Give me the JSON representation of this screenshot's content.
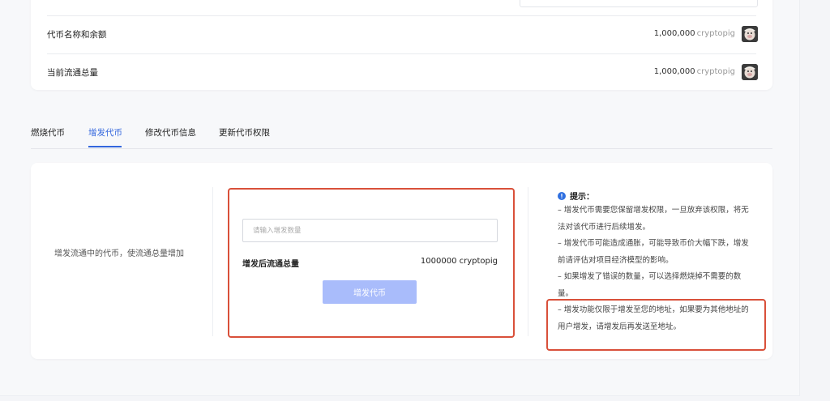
{
  "token_info": {
    "rows": [
      {
        "label": "代币名称和余额",
        "value": "1,000,000",
        "unit": "cryptopig"
      },
      {
        "label": "当前流通总量",
        "value": "1,000,000",
        "unit": "cryptopig"
      }
    ]
  },
  "tabs": [
    {
      "label": "燃烧代币",
      "active": false
    },
    {
      "label": "增发代币",
      "active": true
    },
    {
      "label": "修改代币信息",
      "active": false
    },
    {
      "label": "更新代币权限",
      "active": false
    }
  ],
  "issue_panel": {
    "description": "增发流通中的代币，使流通总量增加",
    "input_placeholder": "请输入增发数量",
    "input_value": "",
    "after_label": "增发后流通总量",
    "after_value": "1000000 cryptopig",
    "button_label": "增发代币"
  },
  "tips": {
    "title": "提示：",
    "items": [
      "– 增发代币需要您保留增发权限，一旦放弃该权限，将无法对该代币进行后续增发。",
      "– 增发代币可能造成通胀，可能导致币价大幅下跌，增发前请评估对项目经济模型的影响。",
      "– 如果增发了错误的数量，可以选择燃烧掉不需要的数量。",
      "– 增发功能仅限于增发至您的地址，如果要为其他地址的用户增发，请增发后再发送至地址。"
    ]
  },
  "colors": {
    "accent": "#3366dd",
    "button_disabled": "#a9bcfb",
    "annotation_red": "#d9503a",
    "info_icon": "#2f6fe0"
  },
  "icons": {
    "token_avatar": "cryptopig-avatar",
    "tips_icon": "info-icon"
  }
}
